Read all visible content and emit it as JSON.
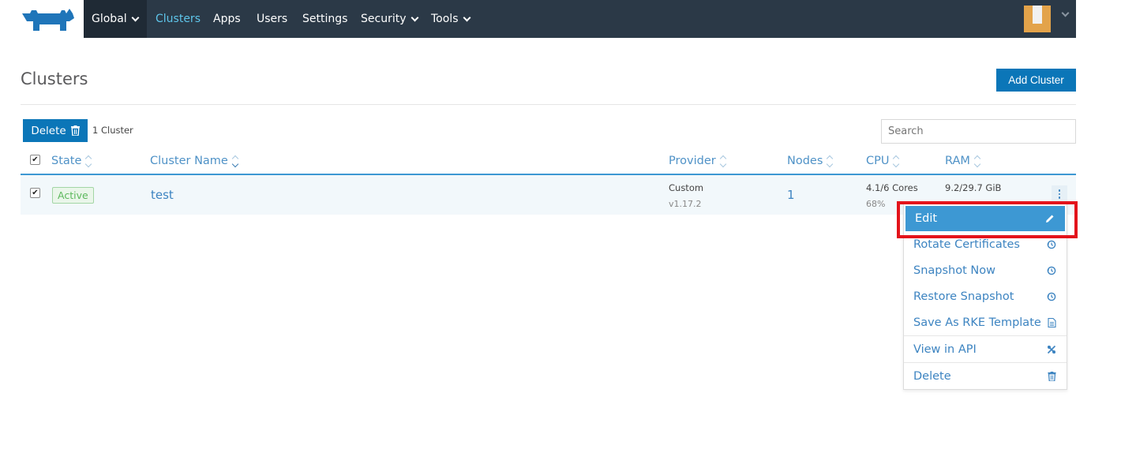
{
  "nav": {
    "global_label": "Global",
    "items": [
      {
        "label": "Clusters",
        "active": true
      },
      {
        "label": "Apps"
      },
      {
        "label": "Users"
      },
      {
        "label": "Settings"
      },
      {
        "label": "Security",
        "dropdown": true
      },
      {
        "label": "Tools",
        "dropdown": true
      }
    ]
  },
  "page": {
    "title": "Clusters",
    "add_button": "Add Cluster"
  },
  "toolbar": {
    "delete_label": "Delete",
    "count_text": "1 Cluster",
    "search_placeholder": "Search"
  },
  "table": {
    "headers": {
      "state": "State",
      "name": "Cluster Name",
      "provider": "Provider",
      "nodes": "Nodes",
      "cpu": "CPU",
      "ram": "RAM"
    },
    "rows": [
      {
        "checked": true,
        "state": "Active",
        "name": "test",
        "provider": "Custom",
        "provider_version": "v1.17.2",
        "nodes": "1",
        "cpu": "4.1/6 Cores",
        "cpu_pct": "68%",
        "ram": "9.2/29.7 GiB"
      }
    ]
  },
  "menu": {
    "items": [
      {
        "label": "Edit",
        "icon": "pencil-icon",
        "selected": true
      },
      {
        "label": "Rotate Certificates",
        "icon": "history-icon"
      },
      {
        "label": "Snapshot Now",
        "icon": "history-icon"
      },
      {
        "label": "Restore Snapshot",
        "icon": "history-icon"
      },
      {
        "label": "Save As RKE Template",
        "icon": "file-icon"
      },
      {
        "label": "View in API",
        "icon": "api-icon"
      },
      {
        "label": "Delete",
        "icon": "trash-icon"
      }
    ]
  },
  "colors": {
    "nav_bg": "#2b3947",
    "primary": "#0b76b8",
    "link": "#3d84c1",
    "active_green": "#5cb85c",
    "highlight_red": "#e3131b"
  }
}
